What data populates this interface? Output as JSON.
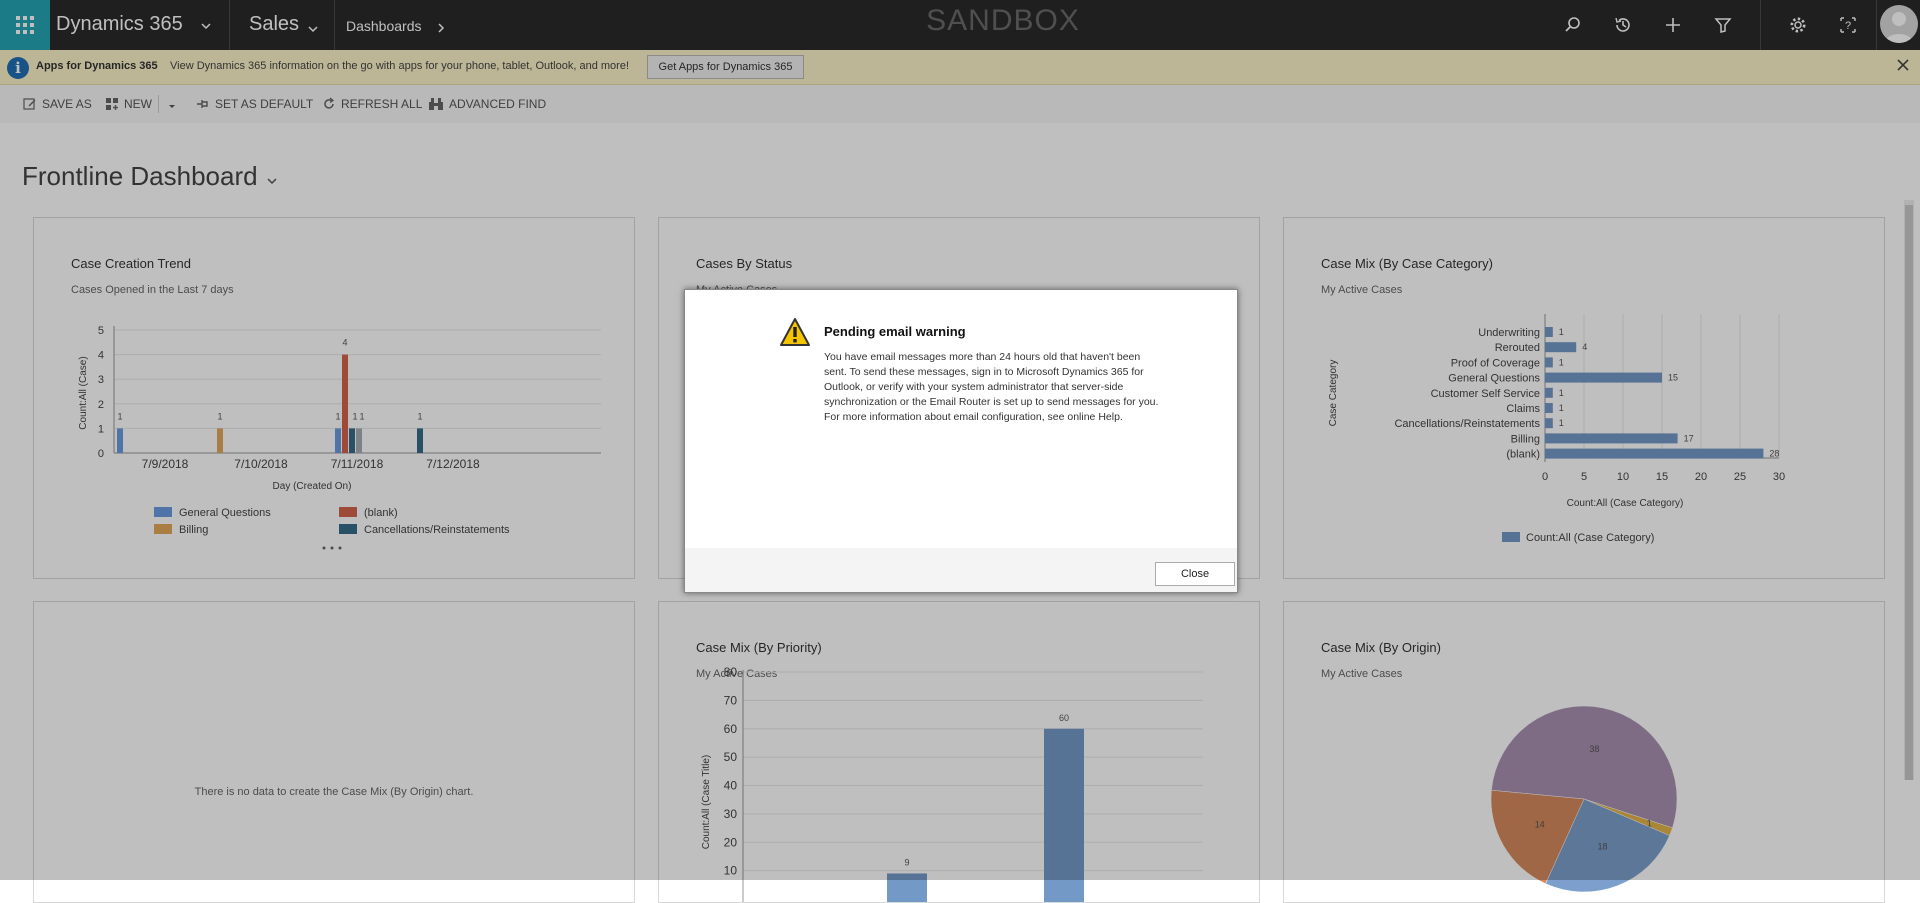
{
  "nav": {
    "app_name": "Dynamics 365",
    "area": "Sales",
    "crumb": "Dashboards",
    "env_label": "SANDBOX"
  },
  "banner": {
    "title": "Apps for Dynamics 365",
    "text": "View Dynamics 365 information on the go with apps for your phone, tablet, Outlook, and more!",
    "button": "Get Apps for Dynamics 365"
  },
  "commands": {
    "save_as": "SAVE AS",
    "new": "NEW",
    "set_default": "SET AS DEFAULT",
    "refresh_all": "REFRESH ALL",
    "advanced_find": "ADVANCED FIND"
  },
  "dashboard": {
    "title": "Frontline Dashboard"
  },
  "cards": {
    "trend": {
      "title": "Case Creation Trend",
      "subtitle": "Cases Opened in the Last 7 days"
    },
    "status": {
      "title": "Cases By Status",
      "subtitle": "My Active Cases"
    },
    "category": {
      "title": "Case Mix (By Case Category)",
      "subtitle": "My Active Cases"
    },
    "empty": {
      "message": "There is no data to create the Case Mix (By Origin) chart."
    },
    "priority": {
      "title": "Case Mix (By Priority)",
      "subtitle": "My Active Cases"
    },
    "origin": {
      "title": "Case Mix (By Origin)",
      "subtitle": "My Active Cases"
    }
  },
  "dialog": {
    "title": "Pending email warning",
    "body": "You have email messages more than 24 hours old that haven't been sent. To send these messages, sign in to Microsoft Dynamics 365 for Outlook, or verify with your system administrator that server-side synchronization or the Email Router is set up to send messages for you. For more information about email configuration, see online Help.",
    "close_label": "Close"
  },
  "colors": {
    "general_questions": "#6d9be0",
    "blank": "#d2634b",
    "billing": "#e0a95c",
    "cancellations": "#366b8a",
    "bar_blue": "#7399c6"
  },
  "chart_data": [
    {
      "type": "bar",
      "title": "Case Creation Trend",
      "subtitle": "Cases Opened in the Last 7 days",
      "xlabel": "Day (Created On)",
      "ylabel": "Count:All (Case)",
      "ylim": [
        0,
        5
      ],
      "yticks": [
        0,
        1,
        2,
        3,
        4,
        5
      ],
      "categories": [
        "7/9/2018",
        "7/10/2018",
        "7/11/2018",
        "7/12/2018"
      ],
      "series": [
        {
          "name": "General Questions",
          "values": [
            1,
            0,
            1,
            0
          ]
        },
        {
          "name": "Billing",
          "values": [
            0,
            1,
            0,
            0
          ]
        },
        {
          "name": "(blank)",
          "values": [
            0,
            0,
            4,
            0
          ]
        },
        {
          "name": "Cancellations/Reinstatements",
          "values": [
            0,
            0,
            1,
            1
          ]
        },
        {
          "name": "",
          "values": [
            0,
            0,
            1,
            0
          ]
        }
      ],
      "legend": [
        "General Questions",
        "(blank)",
        "Billing",
        "Cancellations/Reinstatements"
      ]
    },
    {
      "type": "bar",
      "orientation": "horizontal",
      "title": "Case Mix (By Case Category)",
      "subtitle": "My Active Cases",
      "xlabel": "Count:All (Case Category)",
      "ylabel": "Case Category",
      "xlim": [
        0,
        30
      ],
      "xticks": [
        0,
        5,
        10,
        15,
        20,
        25,
        30
      ],
      "categories": [
        "Underwriting",
        "Rerouted",
        "Proof of Coverage",
        "General Questions",
        "Customer Self Service",
        "Claims",
        "Cancellations/Reinstatements",
        "Billing",
        "(blank)"
      ],
      "values": [
        1,
        4,
        1,
        15,
        1,
        1,
        1,
        17,
        28
      ],
      "legend": [
        "Count:All (Case Category)"
      ]
    },
    {
      "type": "bar",
      "title": "Case Mix (By Priority)",
      "subtitle": "My Active Cases",
      "ylabel": "Count:All (Case Title)",
      "ylim": [
        0,
        80
      ],
      "yticks": [
        10,
        20,
        30,
        40,
        50,
        60,
        70,
        80
      ],
      "values": [
        9,
        60
      ]
    },
    {
      "type": "pie",
      "title": "Case Mix (By Origin)",
      "subtitle": "My Active Cases",
      "values": [
        38,
        1,
        18,
        14
      ],
      "colors": [
        "#a98fb0",
        "#e3b34a",
        "#7c9fcd",
        "#d68a5e"
      ]
    }
  ]
}
